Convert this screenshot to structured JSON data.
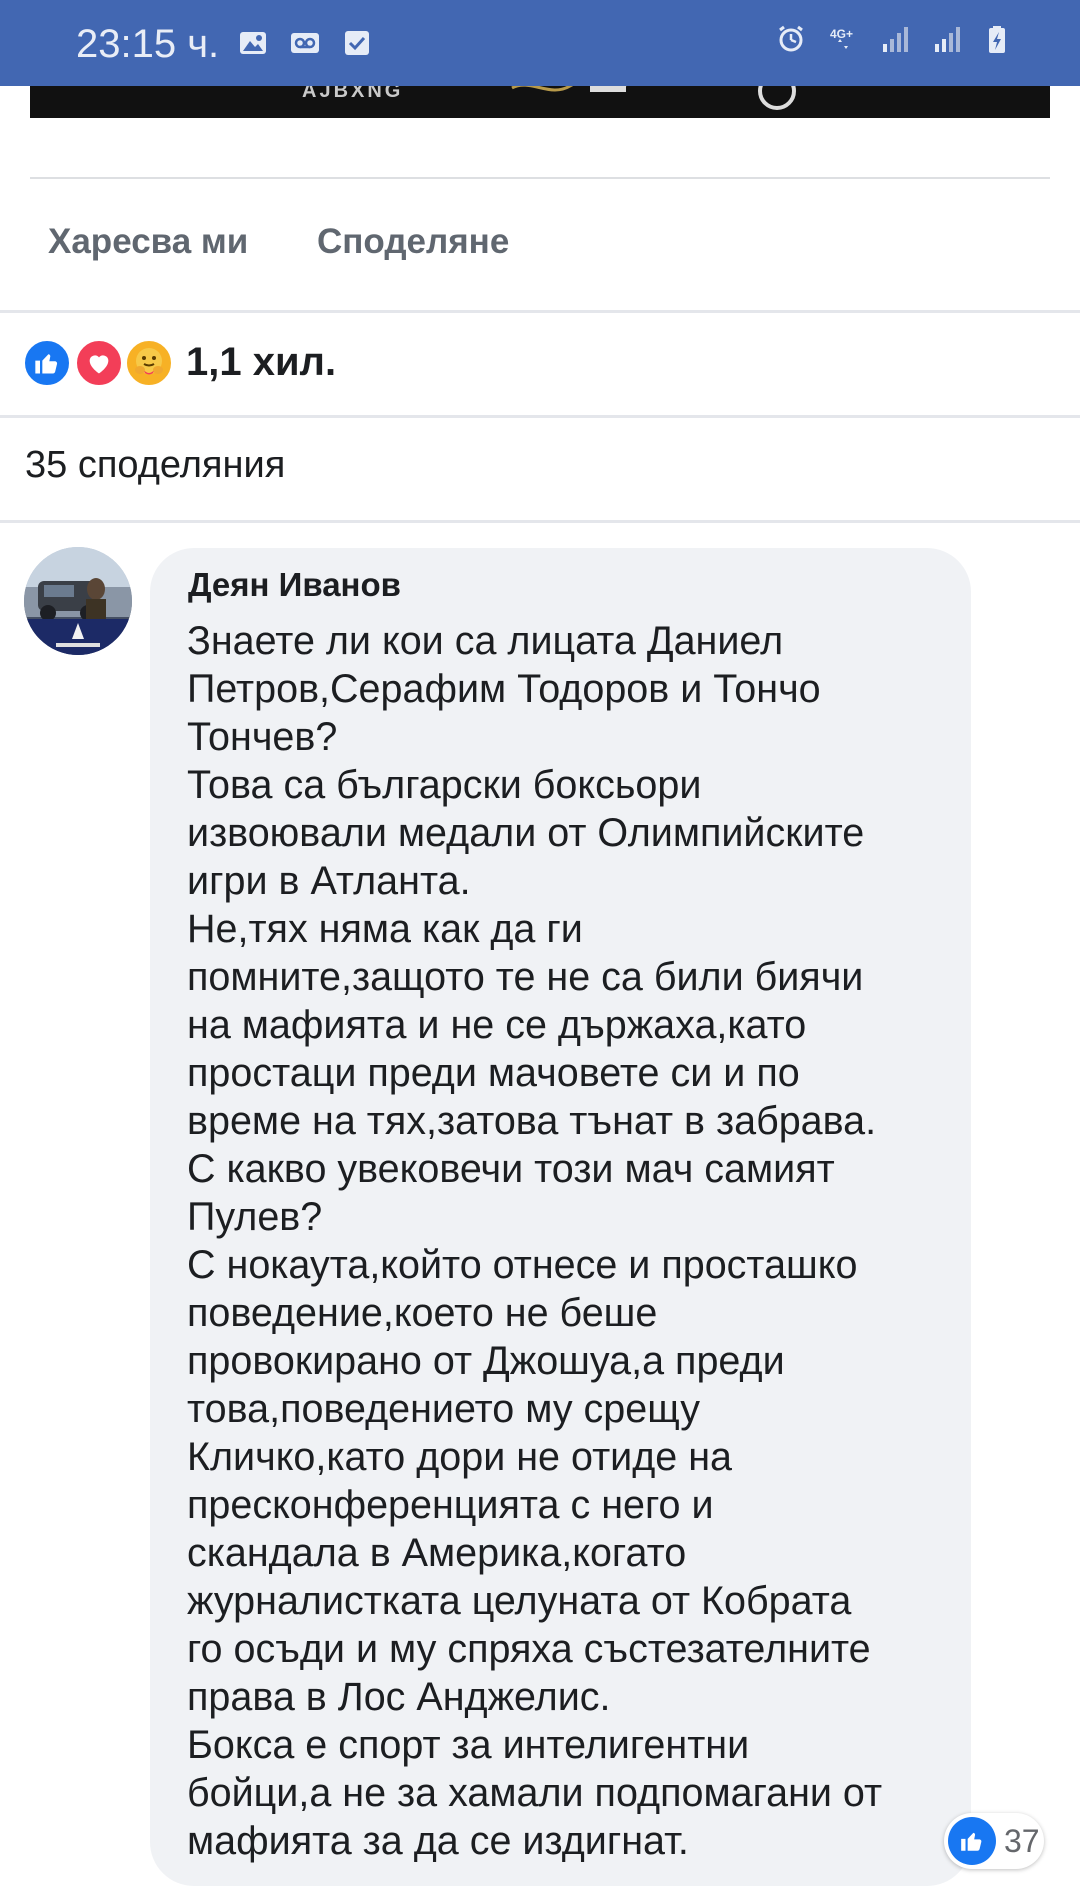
{
  "status_bar": {
    "time": "23:15 ч.",
    "left_icons": [
      "gallery-icon",
      "voicemail-icon",
      "checkbox-icon"
    ],
    "right_icons": [
      "alarm-icon",
      "4g-plus-icon",
      "signal-icon",
      "signal-icon",
      "battery-charging-icon"
    ],
    "network_label": "4G+"
  },
  "video_strip": {
    "logo_text": "AJBXNG"
  },
  "actions": {
    "like_label": "Харесва ми",
    "share_label": "Споделяне"
  },
  "reactions": {
    "types": [
      "like-icon",
      "love-icon",
      "care-icon"
    ],
    "count": "1,1 хил."
  },
  "shares": {
    "label": "35 споделяния"
  },
  "comment": {
    "author": "Деян Иванов",
    "lines": [
      "Знаете ли кои са лицата Даниел",
      "Петров,Серафим Тодоров и Тончо",
      "Тончев?",
      "Това са български боксьори",
      "извоювали медали от Олимпийските",
      "игри в Атланта.",
      "Не,тях няма как да ги",
      "помните,защото те не са били биячи",
      "на мафията и не се държаха,като",
      "простаци преди мачовете си и по",
      "време на тях,затова тънат в забрава.",
      "С какво увековечи този мач самият",
      "Пулев?",
      "С нокаута,който отнесе и просташко",
      "поведение,което не беше",
      "провокирано от Джошуа,а преди",
      "това,поведението му срещу",
      "Кличко,като дори не отиде на",
      "пресконференцията с него и",
      "скандала в Америка,когато",
      "журналистката целуната от Кобрата",
      "го осъди и му спряха състезателните",
      "права в Лос Анджелис.",
      "Бокса е спорт за интелигентни",
      "бойци,а не за хамали подпомагани от",
      "мафията за да се издигнат."
    ],
    "reaction_count": "37"
  },
  "colors": {
    "status_bar": "#4267b2",
    "bubble": "#f0f2f5",
    "like_blue": "#1877f2",
    "love_red": "#f33e58",
    "care_yellow": "#f7b125"
  }
}
